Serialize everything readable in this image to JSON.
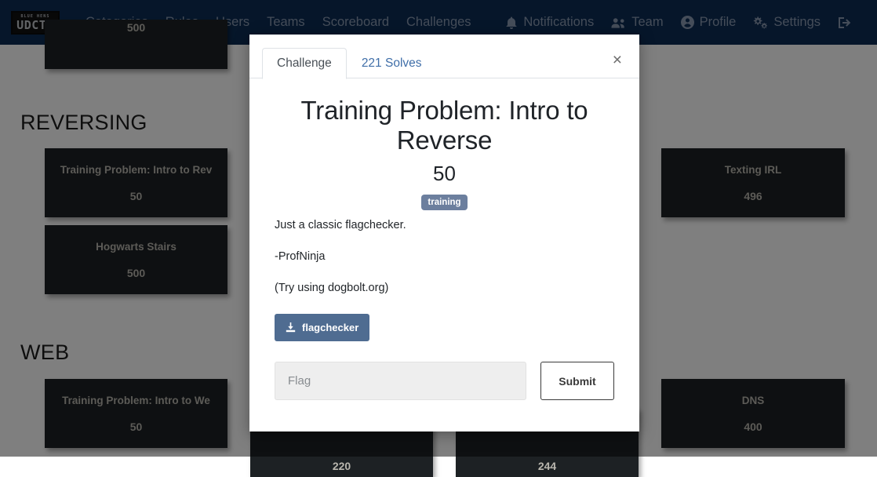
{
  "navbar": {
    "brand": {
      "top_text": "BLUE HENS",
      "main_text": "UDCTF"
    },
    "left_links": [
      {
        "label": "Categories"
      },
      {
        "label": "Rules"
      },
      {
        "label": "Users"
      },
      {
        "label": "Teams"
      },
      {
        "label": "Scoreboard"
      },
      {
        "label": "Challenges"
      }
    ],
    "right_links": [
      {
        "label": "Notifications",
        "icon": "bell-icon"
      },
      {
        "label": "Team",
        "icon": "users-icon"
      },
      {
        "label": "Profile",
        "icon": "user-circle-icon"
      },
      {
        "label": "Settings",
        "icon": "gears-icon"
      },
      {
        "label": "",
        "icon": "logout-icon"
      }
    ]
  },
  "page": {
    "categories": [
      {
        "title": "REVERSING"
      },
      {
        "title": "WEB"
      }
    ],
    "cards": {
      "top_left": {
        "name": "",
        "points": "500"
      },
      "reversing_1": {
        "name": "Training Problem: Intro to Rev",
        "points": "50"
      },
      "reversing_2": {
        "name": "Hogwarts Stairs",
        "points": "500"
      },
      "web_1": {
        "name": "Training Problem: Intro to We",
        "points": "50"
      },
      "right_1": {
        "name": "Texting IRL",
        "points": "496"
      },
      "right_2": {
        "name": "DNS",
        "points": "400"
      },
      "bottom_mid_1": {
        "name": "",
        "points": "220"
      },
      "bottom_mid_2": {
        "name": "",
        "points": "244"
      }
    }
  },
  "modal": {
    "tabs": [
      {
        "label": "Challenge",
        "active": true
      },
      {
        "label": "221 Solves",
        "active": false
      }
    ],
    "close_label": "×",
    "title": "Training Problem: Intro to Reverse",
    "points": "50",
    "tags": [
      "training"
    ],
    "description": [
      "Just a classic flagchecker.",
      "-ProfNinja",
      "(Try using dogbolt.org)"
    ],
    "download": {
      "label": "flagchecker",
      "icon": "download-icon"
    },
    "flag_input": {
      "value": "",
      "placeholder": "Flag"
    },
    "submit_label": "Submit"
  },
  "colors": {
    "navbar": "#0c2d55",
    "card": "#1d2124",
    "tag": "#6c7f9e",
    "download_button": "#4f6c91",
    "overlay": "rgba(0,0,0,0.5)"
  }
}
